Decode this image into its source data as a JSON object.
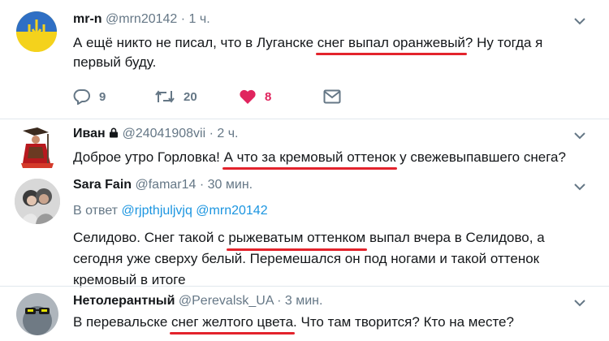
{
  "tweets": [
    {
      "name": "mr-n",
      "handle": "@mrn20142",
      "time": "1 ч.",
      "text_before": "А ещё никто не писал, что в Луганске ",
      "text_highlight": "снег выпал оранжевый",
      "text_after": "? Ну тогда я первый буду.",
      "actions": {
        "replies": "9",
        "retweets": "20",
        "likes": "8"
      }
    },
    {
      "name": "Иван",
      "handle": "@24041908vii",
      "time": "2 ч.",
      "text_before": "Доброе утро Горловка! ",
      "text_highlight": "А что за кремовый оттенок",
      "text_after": " у свежевыпавшего снега?"
    },
    {
      "name": "Sara Fain",
      "handle": "@famar14",
      "time": "30 мин.",
      "reply_prefix": "В ответ ",
      "reply_to": [
        "@rjpthjuljvjq",
        "@mrn20142"
      ],
      "text_before": "Селидово. Снег такой с ",
      "text_highlight": "рыжеватым оттенком",
      "text_line1_after": " выпал вчера в Селидово, а",
      "text_line2": "сегодня уже сверху белый. Перемешался он под ногами и такой оттенок",
      "text_line3": "кремовый в итоге"
    },
    {
      "name": "Нетолерантный",
      "handle": "@Perevalsk_UA",
      "time": "3 мин.",
      "text_before": "В перевальске ",
      "text_highlight": "снег желтого цвета",
      "text_after": ". Что там творится? Кто на месте?"
    }
  ],
  "dot": "·",
  "colors": {
    "link": "#1b95e0",
    "like": "#e0245e",
    "underline": "#e3232c",
    "muted": "#657786"
  }
}
